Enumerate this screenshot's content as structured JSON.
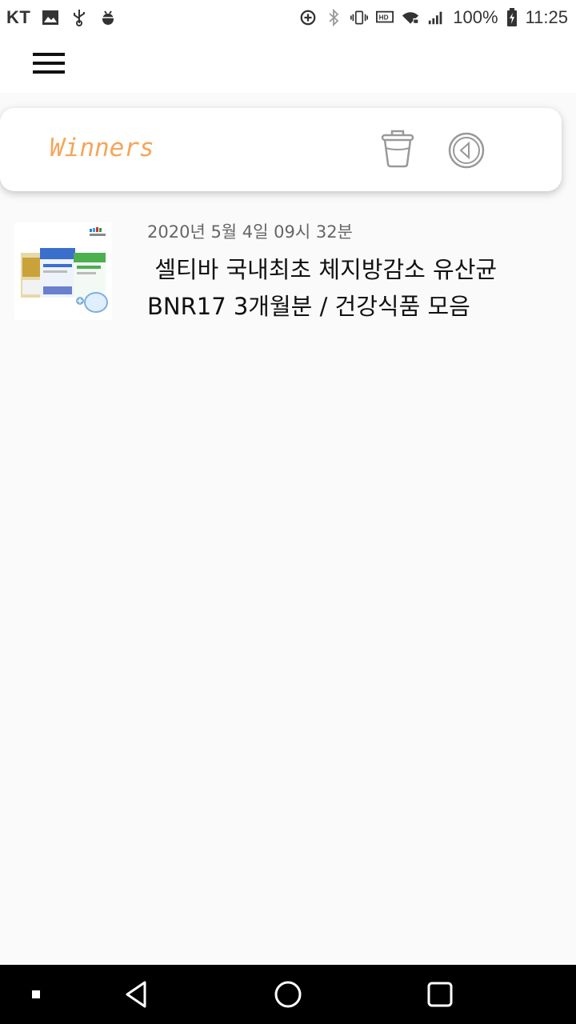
{
  "status_bar": {
    "carrier": "KT",
    "battery_percent": "100%",
    "time": "11:25",
    "icons": [
      "image-icon",
      "usb-icon",
      "android-debug-icon",
      "data-saver-icon",
      "bluetooth-icon",
      "vibrate-icon",
      "hd-icon",
      "wifi-icon",
      "signal-icon",
      "battery-icon"
    ]
  },
  "app_bar": {
    "menu_icon": "hamburger-menu-icon"
  },
  "header": {
    "title": "Winners",
    "title_color": "#f4a65a",
    "actions": [
      "trash-icon",
      "back-circle-icon"
    ]
  },
  "list": {
    "items": [
      {
        "date": "2020년 5월 4일 09시 32분",
        "title": " 셀티바 국내최초 체지방감소 유산균 BNR17 3개월분 / 건강식품 모음",
        "thumbnail": "product-thumbnail"
      }
    ]
  },
  "nav_bar": {
    "buttons": [
      "square-dot-icon",
      "back-triangle-icon",
      "home-circle-icon",
      "recents-square-icon"
    ]
  }
}
